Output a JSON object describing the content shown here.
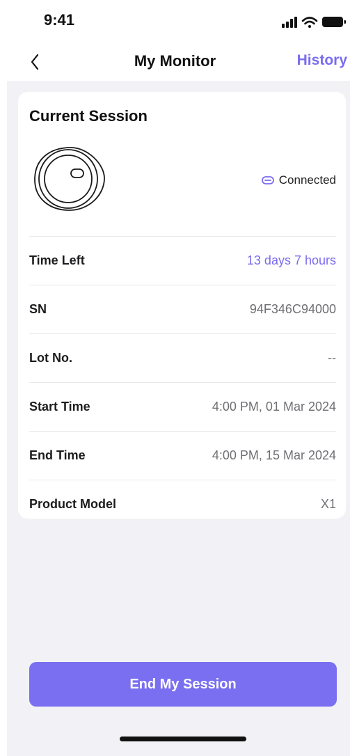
{
  "status_bar": {
    "time": "9:41",
    "icons": [
      "signal-icon",
      "wifi-icon",
      "battery-icon"
    ]
  },
  "nav": {
    "title": "My Monitor",
    "right_link": "History",
    "back_icon": "chevron-left-icon"
  },
  "card": {
    "title": "Current Session",
    "device_icon": "monitor-sensor-icon",
    "connection": {
      "icon": "link-icon",
      "label": "Connected"
    },
    "rows": [
      {
        "label": "Time Left",
        "value": "13 days 7 hours"
      },
      {
        "label": "SN",
        "value": "94F346C94000"
      },
      {
        "label": "Lot No.",
        "value": "--"
      },
      {
        "label": "Start Time",
        "value": "4:00 PM, 01 Mar 2024"
      },
      {
        "label": "End Time",
        "value": "4:00 PM, 15 Mar 2024"
      },
      {
        "label": "Product Model",
        "value": "X1"
      }
    ]
  },
  "end_button": {
    "label": "End My Session"
  },
  "colors": {
    "accent": "#7a6cf0",
    "button": "#7a6ff0",
    "background": "#f2f2f6"
  }
}
